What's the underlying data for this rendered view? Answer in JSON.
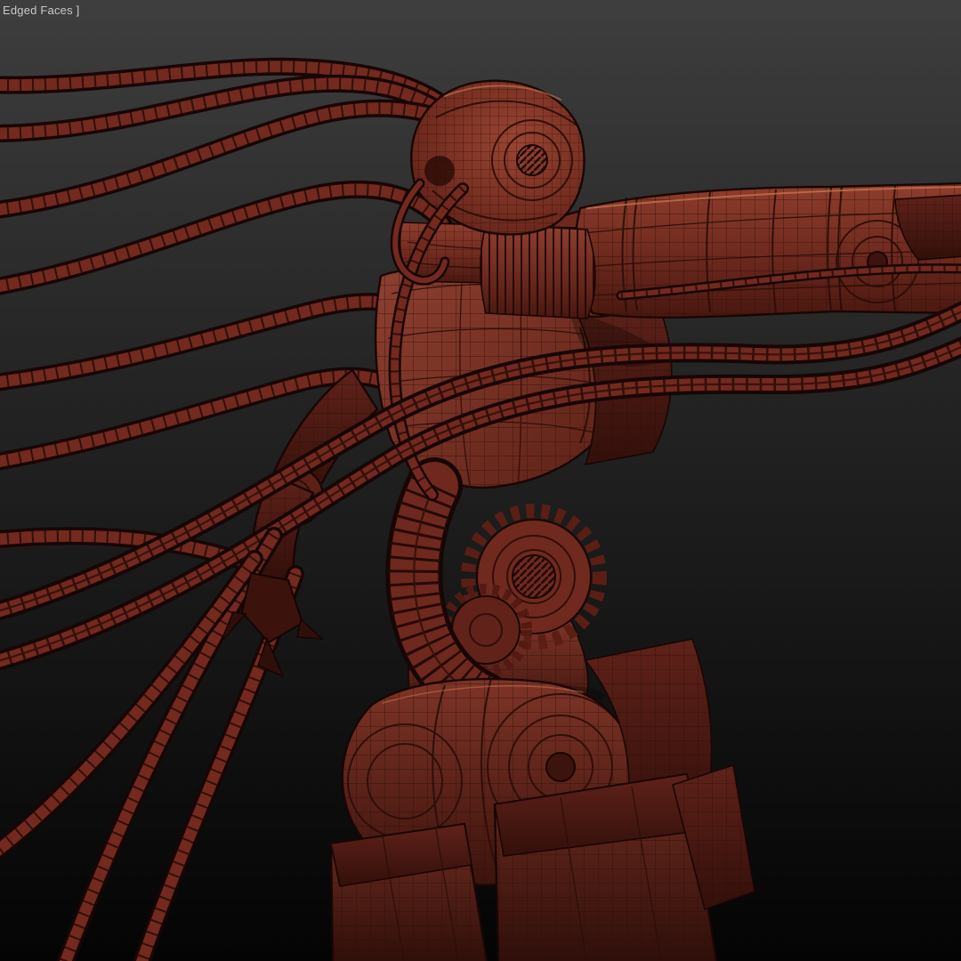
{
  "viewport": {
    "shading_label": "Edged Faces ]"
  },
  "colors": {
    "background_top": "#3e3e3e",
    "background_mid": "#262626",
    "background_bottom": "#040404",
    "label_text": "#c9c9c9",
    "model_base": "#83352a",
    "model_highlight": "#c97a55",
    "model_dark": "#48170f",
    "wireframe": "#2c0e08",
    "outline": "#190604",
    "cable_core": "#73291e",
    "cable_outline": "#170605"
  },
  "scene": {
    "object_parts": [
      "cables",
      "head",
      "collar",
      "torso",
      "right-arm",
      "left-arm",
      "abdomen-tube",
      "gears",
      "pelvis",
      "legs"
    ]
  }
}
